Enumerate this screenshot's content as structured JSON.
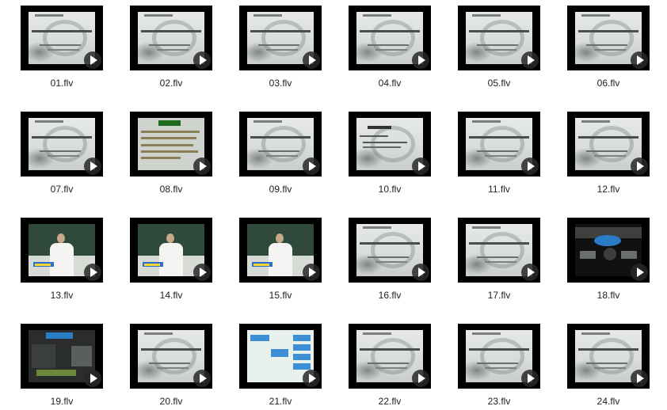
{
  "files": [
    {
      "name": "01.flv",
      "thumb": "slide"
    },
    {
      "name": "02.flv",
      "thumb": "slide"
    },
    {
      "name": "03.flv",
      "thumb": "slide"
    },
    {
      "name": "04.flv",
      "thumb": "slide"
    },
    {
      "name": "05.flv",
      "thumb": "slide"
    },
    {
      "name": "06.flv",
      "thumb": "slide"
    },
    {
      "name": "07.flv",
      "thumb": "slide"
    },
    {
      "name": "08.flv",
      "thumb": "green"
    },
    {
      "name": "09.flv",
      "thumb": "slide"
    },
    {
      "name": "10.flv",
      "thumb": "slide-box"
    },
    {
      "name": "11.flv",
      "thumb": "slide"
    },
    {
      "name": "12.flv",
      "thumb": "slide"
    },
    {
      "name": "13.flv",
      "thumb": "classroom"
    },
    {
      "name": "14.flv",
      "thumb": "classroom"
    },
    {
      "name": "15.flv",
      "thumb": "classroom"
    },
    {
      "name": "16.flv",
      "thumb": "slide"
    },
    {
      "name": "17.flv",
      "thumb": "slide"
    },
    {
      "name": "18.flv",
      "thumb": "dark-a"
    },
    {
      "name": "19.flv",
      "thumb": "dark-b"
    },
    {
      "name": "20.flv",
      "thumb": "slide"
    },
    {
      "name": "21.flv",
      "thumb": "diagram"
    },
    {
      "name": "22.flv",
      "thumb": "slide"
    },
    {
      "name": "23.flv",
      "thumb": "slide"
    },
    {
      "name": "24.flv",
      "thumb": "slide"
    }
  ]
}
